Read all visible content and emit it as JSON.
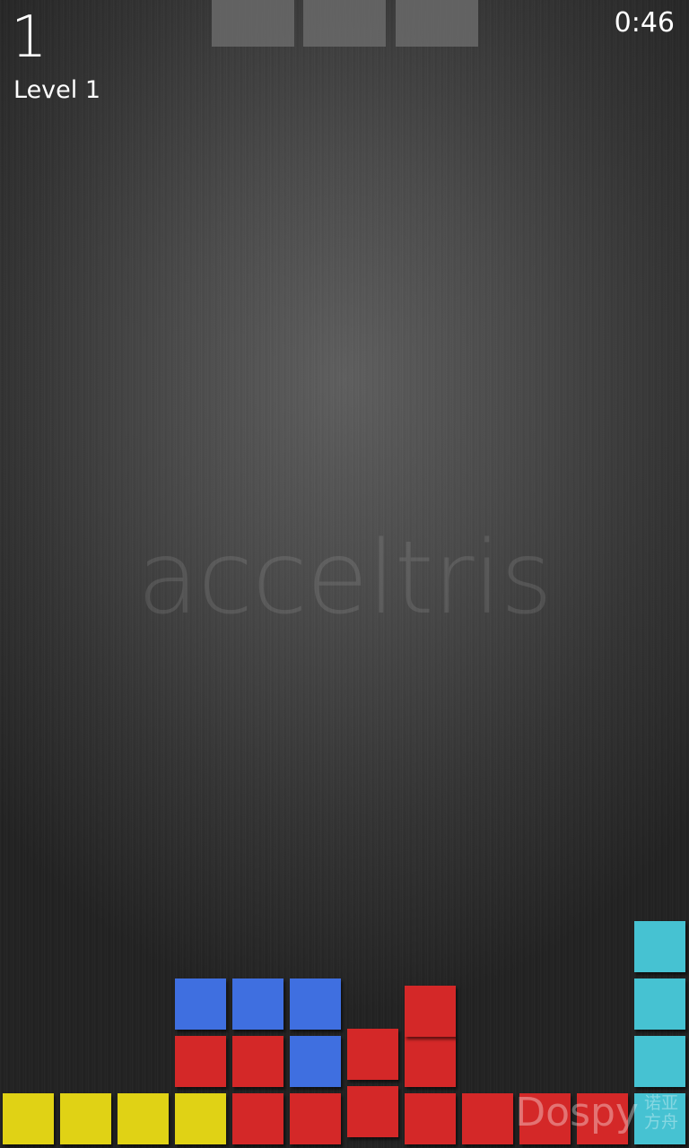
{
  "hud": {
    "score": "1",
    "level": "Level 1",
    "timer": "0:46"
  },
  "next_preview": {
    "slots": 3,
    "color": "#6a6a6a"
  },
  "logo": {
    "text": "acceltris"
  },
  "watermark": {
    "text": "Dospy",
    "sub_line1": "诺亚",
    "sub_line2": "方舟"
  },
  "board": {
    "columns": 12,
    "rows_visible": 4,
    "colors": {
      "yellow": "#e0d215",
      "blue": "#3f6fe0",
      "red": "#d42828",
      "cyan": "#46c2d2"
    },
    "blocks": [
      {
        "col": 0,
        "row": 0,
        "color": "yellow"
      },
      {
        "col": 1,
        "row": 0,
        "color": "yellow"
      },
      {
        "col": 2,
        "row": 0,
        "color": "yellow"
      },
      {
        "col": 3,
        "row": 0,
        "color": "yellow"
      },
      {
        "col": 4,
        "row": 0,
        "color": "red"
      },
      {
        "col": 5,
        "row": 0,
        "color": "red"
      },
      {
        "col": 6,
        "row": 0,
        "color": "red",
        "offset": -0.13
      },
      {
        "col": 7,
        "row": 0,
        "color": "red"
      },
      {
        "col": 8,
        "row": 0,
        "color": "red"
      },
      {
        "col": 9,
        "row": 0,
        "color": "red"
      },
      {
        "col": 10,
        "row": 0,
        "color": "red"
      },
      {
        "col": 11,
        "row": 0,
        "color": "cyan"
      },
      {
        "col": 3,
        "row": 1,
        "color": "red"
      },
      {
        "col": 4,
        "row": 1,
        "color": "red"
      },
      {
        "col": 5,
        "row": 1,
        "color": "blue"
      },
      {
        "col": 6,
        "row": 1,
        "color": "red",
        "offset": -0.13
      },
      {
        "col": 7,
        "row": 1,
        "color": "red"
      },
      {
        "col": 11,
        "row": 1,
        "color": "cyan"
      },
      {
        "col": 3,
        "row": 2,
        "color": "blue"
      },
      {
        "col": 4,
        "row": 2,
        "color": "blue"
      },
      {
        "col": 5,
        "row": 2,
        "color": "blue"
      },
      {
        "col": 7,
        "row": 2,
        "color": "red",
        "offset": 0.13
      },
      {
        "col": 11,
        "row": 2,
        "color": "cyan"
      },
      {
        "col": 11,
        "row": 3,
        "color": "cyan"
      }
    ]
  }
}
